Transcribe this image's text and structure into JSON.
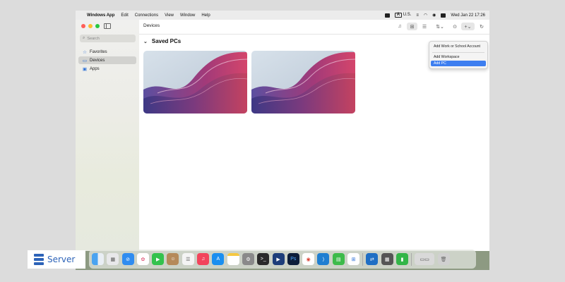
{
  "menubar": {
    "apple_glyph": "",
    "app_name": "Windows App",
    "menus": [
      "Edit",
      "Connections",
      "View",
      "Window",
      "Help"
    ],
    "input_source": "U.S.",
    "clock": "Wed Jan 22  17:26"
  },
  "sidebar": {
    "search_placeholder": "Search",
    "items": [
      {
        "label": "Favorites",
        "icon": "star-icon"
      },
      {
        "label": "Devices",
        "icon": "monitor-icon",
        "selected": true
      },
      {
        "label": "Apps",
        "icon": "apps-icon"
      }
    ]
  },
  "main": {
    "title": "Devices",
    "section_title": "Saved PCs",
    "pc_cards": [
      {
        "wallpaper": "windows-bloom"
      },
      {
        "wallpaper": "windows-bloom"
      }
    ]
  },
  "dropdown": {
    "options": [
      {
        "label": "Add Work or School Account",
        "highlighted": false
      },
      {
        "label": "Add Workspace",
        "highlighted": false
      },
      {
        "label": "Add PC",
        "highlighted": true
      }
    ]
  },
  "dock": {
    "apps": [
      "finder",
      "launchpad",
      "safari",
      "photos",
      "facetime",
      "contacts",
      "reminders",
      "music",
      "app-store",
      "notes",
      "system-settings",
      "terminal",
      "remote-desktop",
      "photoshop",
      "chrome",
      "vscode",
      "numbers-alt",
      "windows-app",
      "migration",
      "calculator",
      "activity-numbers",
      "screenshot",
      "trash"
    ]
  },
  "watermark": {
    "label": "Server"
  },
  "colors": {
    "accent": "#3d7ef0",
    "watermark_blue": "#2d63b8"
  }
}
